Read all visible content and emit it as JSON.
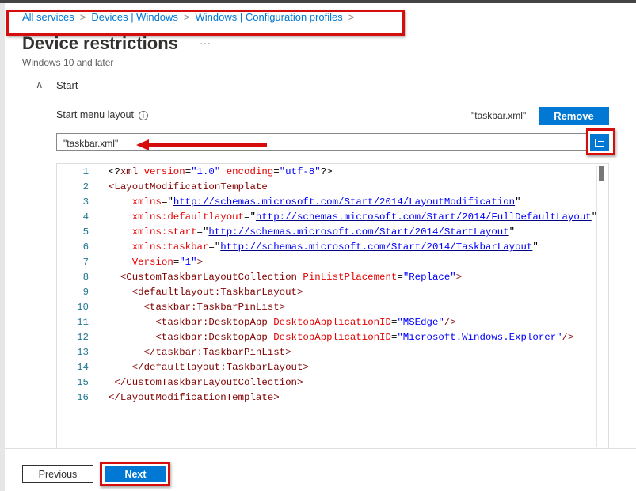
{
  "breadcrumb": [
    "All services",
    "Devices | Windows",
    "Windows | Configuration profiles"
  ],
  "breadcrumb_sep": ">",
  "page": {
    "title": "Device restrictions",
    "more": "···",
    "subtitle": "Windows 10 and later"
  },
  "section": {
    "label": "Start",
    "expanded": true
  },
  "field": {
    "label": "Start menu layout",
    "info": "i",
    "file_name": "\"taskbar.xml\"",
    "remove_label": "Remove",
    "input_value": "\"taskbar.xml\""
  },
  "editor": {
    "lines": [
      [
        [
          "punc",
          "<?"
        ],
        [
          "tag",
          "xml "
        ],
        [
          "attr",
          "version"
        ],
        [
          "punc",
          "="
        ],
        [
          "val",
          "\"1.0\" "
        ],
        [
          "attr",
          "encoding"
        ],
        [
          "punc",
          "="
        ],
        [
          "val",
          "\"utf-8\""
        ],
        [
          "punc",
          "?>"
        ]
      ],
      [
        [
          "tag",
          "<LayoutModificationTemplate"
        ]
      ],
      [
        [
          "punc",
          "    "
        ],
        [
          "attr",
          "xmlns"
        ],
        [
          "punc",
          "=\""
        ],
        [
          "link",
          "http://schemas.microsoft.com/Start/2014/LayoutModification"
        ],
        [
          "punc",
          "\""
        ]
      ],
      [
        [
          "punc",
          "    "
        ],
        [
          "attr",
          "xmlns:defaultlayout"
        ],
        [
          "punc",
          "=\""
        ],
        [
          "link",
          "http://schemas.microsoft.com/Start/2014/FullDefaultLayout"
        ],
        [
          "punc",
          "\""
        ]
      ],
      [
        [
          "punc",
          "    "
        ],
        [
          "attr",
          "xmlns:start"
        ],
        [
          "punc",
          "=\""
        ],
        [
          "link",
          "http://schemas.microsoft.com/Start/2014/StartLayout"
        ],
        [
          "punc",
          "\""
        ]
      ],
      [
        [
          "punc",
          "    "
        ],
        [
          "attr",
          "xmlns:taskbar"
        ],
        [
          "punc",
          "=\""
        ],
        [
          "link",
          "http://schemas.microsoft.com/Start/2014/TaskbarLayout"
        ],
        [
          "punc",
          "\""
        ]
      ],
      [
        [
          "punc",
          "    "
        ],
        [
          "attr",
          "Version"
        ],
        [
          "punc",
          "="
        ],
        [
          "val",
          "\"1\""
        ],
        [
          "tag",
          ">"
        ]
      ],
      [
        [
          "punc",
          "  "
        ],
        [
          "tag",
          "<CustomTaskbarLayoutCollection "
        ],
        [
          "attr",
          "PinListPlacement"
        ],
        [
          "punc",
          "="
        ],
        [
          "val",
          "\"Replace\""
        ],
        [
          "tag",
          ">"
        ]
      ],
      [
        [
          "punc",
          "    "
        ],
        [
          "tag",
          "<defaultlayout:TaskbarLayout>"
        ]
      ],
      [
        [
          "punc",
          "      "
        ],
        [
          "tag",
          "<taskbar:TaskbarPinList>"
        ]
      ],
      [
        [
          "punc",
          "        "
        ],
        [
          "tag",
          "<taskbar:DesktopApp "
        ],
        [
          "attr",
          "DesktopApplicationID"
        ],
        [
          "punc",
          "="
        ],
        [
          "val",
          "\"MSEdge\""
        ],
        [
          "tag",
          "/>"
        ]
      ],
      [
        [
          "punc",
          "        "
        ],
        [
          "tag",
          "<taskbar:DesktopApp "
        ],
        [
          "attr",
          "DesktopApplicationID"
        ],
        [
          "punc",
          "="
        ],
        [
          "val",
          "\"Microsoft.Windows.Explorer\""
        ],
        [
          "tag",
          "/>"
        ]
      ],
      [
        [
          "punc",
          "      "
        ],
        [
          "tag",
          "</taskbar:TaskbarPinList>"
        ]
      ],
      [
        [
          "punc",
          "    "
        ],
        [
          "tag",
          "</defaultlayout:TaskbarLayout>"
        ]
      ],
      [
        [
          "punc",
          " "
        ],
        [
          "tag",
          "</CustomTaskbarLayoutCollection>"
        ]
      ],
      [
        [
          "tag",
          "</LayoutModificationTemplate>"
        ]
      ]
    ]
  },
  "footer": {
    "previous_label": "Previous",
    "next_label": "Next"
  },
  "colors": {
    "accent": "#0078d4",
    "highlight": "#d60d0d"
  }
}
